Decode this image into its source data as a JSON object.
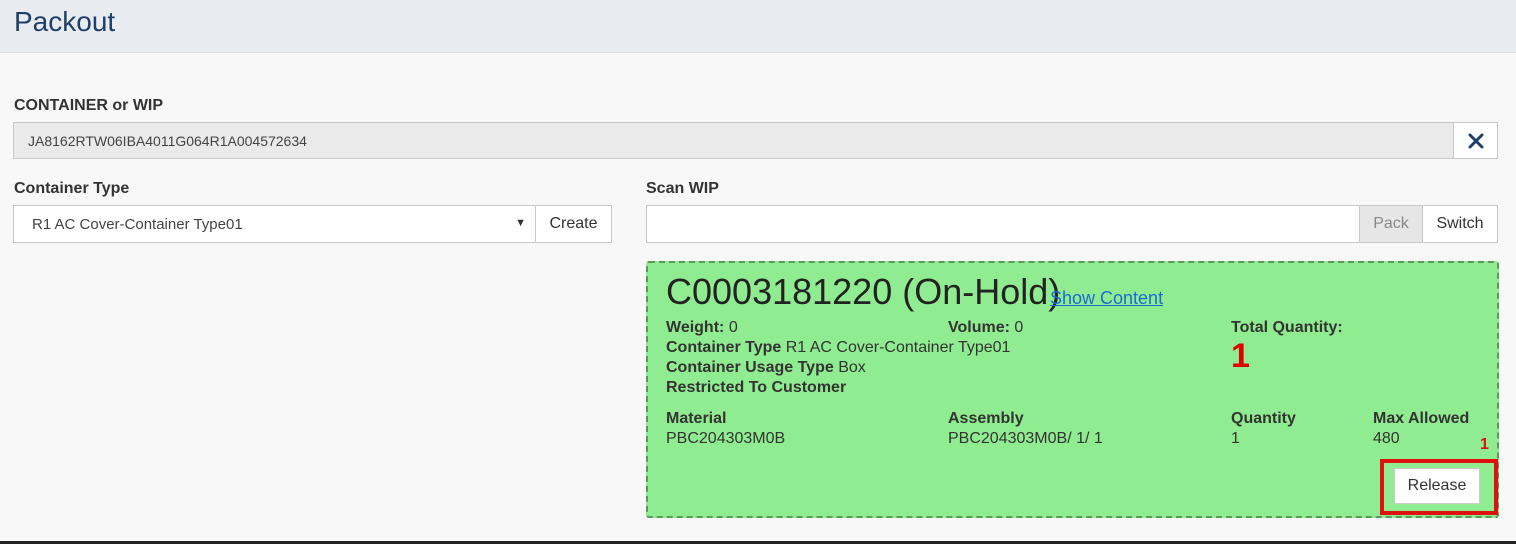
{
  "header": {
    "title": "Packout"
  },
  "container_or_wip": {
    "label": "CONTAINER or WIP",
    "value": "JA8162RTW06IBA4011G064R1A004572634",
    "clear_icon": "close-icon"
  },
  "container_type": {
    "label": "Container Type",
    "selected": "R1 AC Cover-Container Type01",
    "create_label": "Create"
  },
  "scan_wip": {
    "label": "Scan WIP",
    "value": "",
    "pack_label": "Pack",
    "switch_label": "Switch"
  },
  "container_panel": {
    "title": "C0003181220 (On-Hold)",
    "show_content": "Show Content",
    "weight_label": "Weight:",
    "weight_value": "0",
    "volume_label": "Volume:",
    "volume_value": "0",
    "total_qty_label": "Total Quantity:",
    "total_qty_value": "1",
    "container_type_label": "Container Type",
    "container_type_value": "R1 AC Cover-Container Type01",
    "usage_type_label": "Container Usage Type",
    "usage_type_value": "Box",
    "restricted_label": "Restricted To Customer",
    "columns": {
      "material": "Material",
      "assembly": "Assembly",
      "quantity": "Quantity",
      "max_allowed": "Max Allowed"
    },
    "row": {
      "material": "PBC204303M0B",
      "assembly": "PBC204303M0B/ 1/ 1",
      "quantity": "1",
      "max_allowed": "480"
    },
    "release_label": "Release",
    "annotation_number": "1",
    "colors": {
      "background": "#90ec90",
      "highlight": "#e01010"
    }
  }
}
